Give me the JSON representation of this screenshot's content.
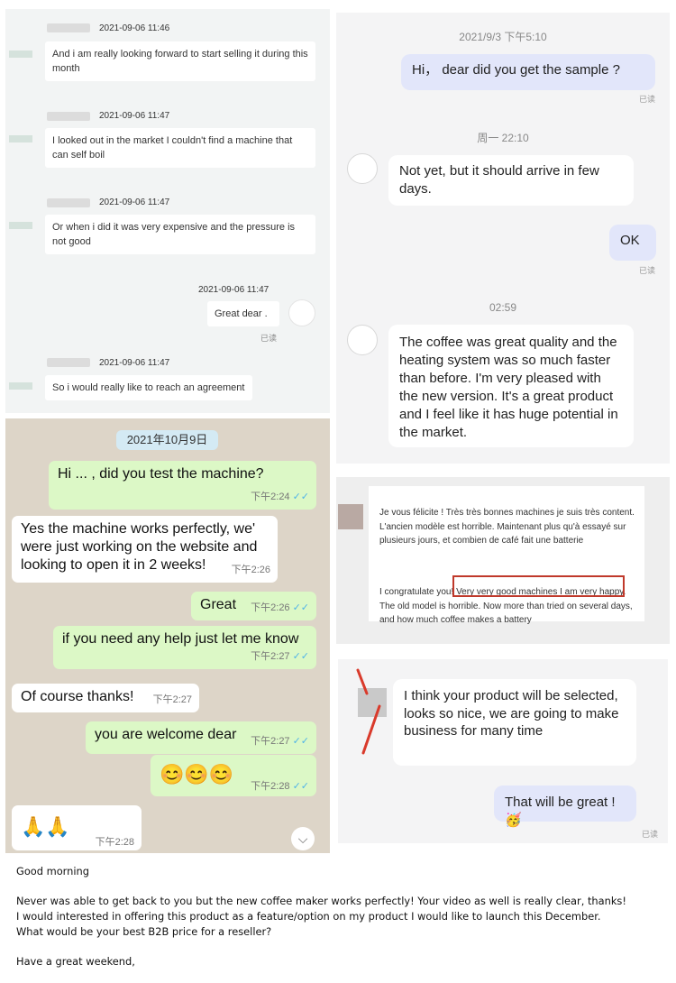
{
  "chat1": {
    "messages": [
      {
        "time": "2021-09-06 11:46",
        "text": "And i am really looking forward to start selling it during this month"
      },
      {
        "time": "2021-09-06 11:47",
        "text": "I looked out in the market I couldn't find a machine that can self boil"
      },
      {
        "time": "2021-09-06 11:47",
        "text": "Or when i did it was very expensive and the pressure is not good"
      },
      {
        "time": "2021-09-06 11:47",
        "text": "Great dear .",
        "read": "已读"
      },
      {
        "time": "2021-09-06 11:47",
        "text": "So i would really like to reach an agreement"
      }
    ]
  },
  "chat2": {
    "ts1": "2021/9/3 下午5:10",
    "msg1": "Hi， dear  did you get the sample ?",
    "read1": "已读",
    "ts2": "周一 22:10",
    "msg2": "Not yet, but it should arrive in few days.",
    "msg3": "OK",
    "read2": "已读",
    "ts3": "02:59",
    "msg4": "The coffee was great quality and the heating system was so much faster than before. I'm very pleased with the new version. It's a great product and I feel like it has huge potential in the market."
  },
  "whatsapp": {
    "date": "2021年10月9日",
    "messages": [
      {
        "text": "Hi ... , did you test the machine?",
        "time": "下午2:24",
        "check": "✓✓"
      },
      {
        "text": "Yes the machine works perfectly, we' were just working on the website and looking to open it in 2 weeks!",
        "time": "下午2:26"
      },
      {
        "text": "Great",
        "time": "下午2:26",
        "check": "✓✓"
      },
      {
        "text": "if you need any help just let me know",
        "time": "下午2:27",
        "check": "✓✓"
      },
      {
        "text": "Of course thanks!",
        "time": "下午2:27"
      },
      {
        "text": "you are welcome dear",
        "time": "下午2:27",
        "check": "✓✓"
      },
      {
        "text": "😊😊😊",
        "time": "下午2:28",
        "check": "✓✓"
      },
      {
        "text": "🙏🙏",
        "time": "下午2:28"
      }
    ],
    "scroll_down_icon": "chevron-double-down"
  },
  "translation": {
    "french": "Je vous félicite ! Très très bonnes machines je suis très content. L'ancien modèle est horrible. Maintenant plus qu'à essayé sur plusieurs jours, et combien de café fait une batterie",
    "english_pre": "I congratulate you!",
    "english_highlight": "Very very good machines I am very happy.",
    "english_post": "The old model is horrible. Now more than tried on several days, and how much coffee makes a battery",
    "highlight_color": "#c0392b"
  },
  "chat3": {
    "msg1": "I think your product will be selected, looks so nice, we are going to make business for many time",
    "msg2": "That will be great !",
    "msg2_emoji": "🥳",
    "read": "已读"
  },
  "email": {
    "greeting": "Good morning",
    "line1": "Never was able to get back to you but the new coffee maker works perfectly! Your video as well is really clear, thanks!",
    "line2": " I would interested in offering this product as a feature/option on my product I would like to launch this December.",
    "line3": "What would be your best B2B price for a reseller?",
    "closing": "Have a great weekend,"
  }
}
